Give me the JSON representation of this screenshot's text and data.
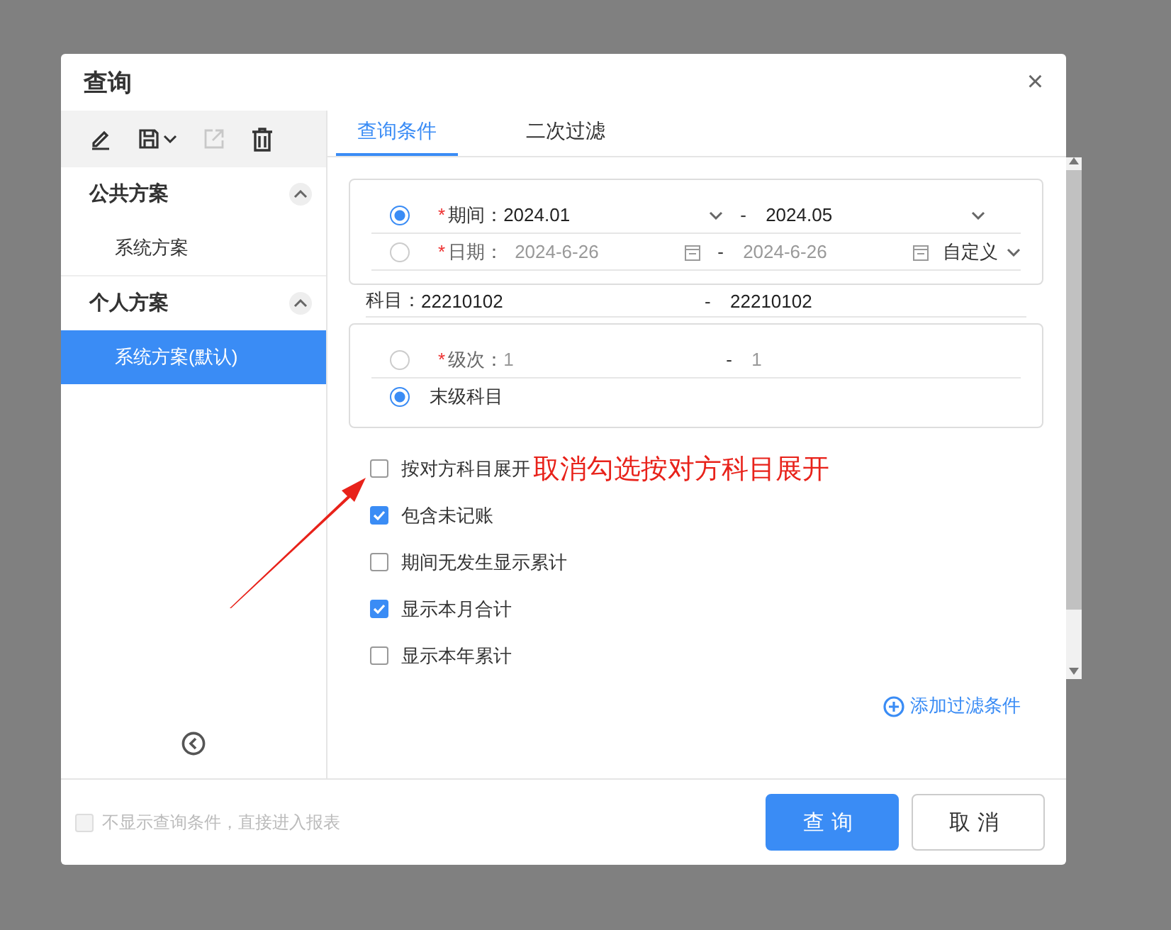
{
  "dialog": {
    "title": "查询",
    "close": "×"
  },
  "sidebar": {
    "toolbar": [
      {
        "kind": "edit",
        "disabled": false
      },
      {
        "kind": "save",
        "disabled": false
      },
      {
        "kind": "export",
        "disabled": true
      },
      {
        "kind": "delete",
        "disabled": false
      }
    ],
    "groups": [
      {
        "title": "公共方案",
        "expanded": true,
        "items": [
          {
            "label": "系统方案",
            "selected": false
          }
        ]
      },
      {
        "title": "个人方案",
        "expanded": true,
        "items": [
          {
            "label": "系统方案(默认)",
            "selected": true
          }
        ]
      }
    ]
  },
  "tabs": [
    {
      "label": "查询条件",
      "selected": true
    },
    {
      "label": "二次过滤",
      "selected": false
    }
  ],
  "date_group": [
    {
      "kind": "select",
      "selected": true,
      "required_mark": "*",
      "disabled": false,
      "label": "期间：",
      "from": "2024.01",
      "separator": "-",
      "to": "2024.05"
    },
    {
      "kind": "date",
      "selected": false,
      "required_mark": "*",
      "disabled": true,
      "label": "日期：",
      "from": "2024-6-26",
      "separator": "-",
      "to": "2024-6-26",
      "preset": "自定义"
    }
  ],
  "account": {
    "label": "科目：",
    "from": "22210102",
    "separator": "-",
    "to": "22210102"
  },
  "level_group": [
    {
      "kind": "range",
      "selected": false,
      "required_mark": "*",
      "disabled": true,
      "label": "级次：",
      "from": "1",
      "separator": "-",
      "to": "1"
    },
    {
      "kind": "plain",
      "selected": true,
      "label": "末级科目"
    }
  ],
  "options": [
    {
      "label": "按对方科目展开",
      "checked": false
    },
    {
      "label": "包含未记账",
      "checked": true
    },
    {
      "label": "期间无发生显示累计",
      "checked": false
    },
    {
      "label": "显示本月合计",
      "checked": true
    },
    {
      "label": "显示本年累计",
      "checked": false
    }
  ],
  "add_filter": "添加过滤条件",
  "footer": {
    "skip_option": {
      "label": "不显示查询条件，直接进入报表",
      "checked": false,
      "disabled": true
    },
    "buttons": [
      {
        "kind": "primary",
        "label": "查询"
      },
      {
        "kind": "default",
        "label": "取消"
      }
    ]
  },
  "annotation": {
    "text": "取消勾选按对方科目展开"
  }
}
